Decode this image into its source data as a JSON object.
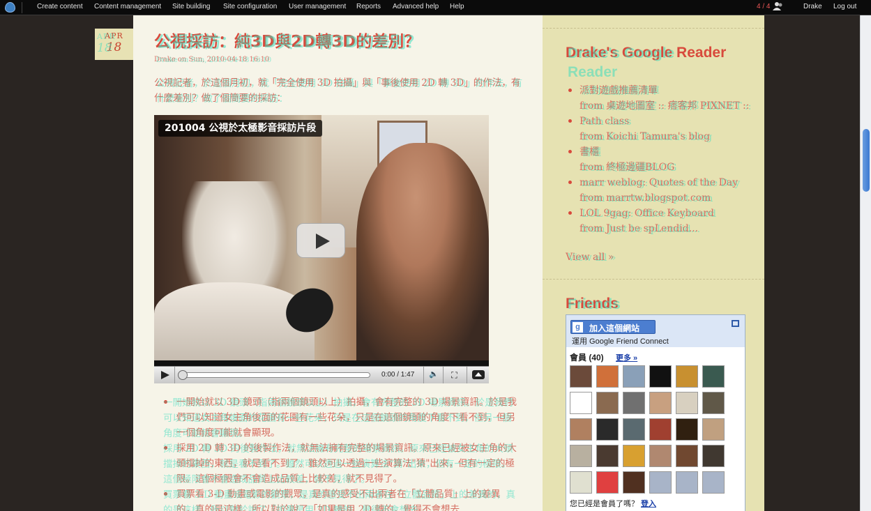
{
  "colors": {
    "accent": "#d84a3c",
    "ghost": "#40dcbe",
    "sidebar_bg": "#e6e2b2",
    "content_bg": "#f6f4e8"
  },
  "admin_bar": {
    "menu": [
      {
        "label": "Create content"
      },
      {
        "label": "Content management"
      },
      {
        "label": "Site building"
      },
      {
        "label": "Site configuration"
      },
      {
        "label": "User management"
      },
      {
        "label": "Reports"
      },
      {
        "label": "Advanced help"
      },
      {
        "label": "Help"
      }
    ],
    "user_count": "4 / 4",
    "user_name": "Drake",
    "logout": "Log out",
    "icons": [
      "drupal-logo",
      "users-icon"
    ]
  },
  "post": {
    "date_month": "APR",
    "date_day": "18",
    "title": "公視採訪：純3D與2D轉3D的差別？",
    "meta": "Drake on Sun, 2010-04-18 16:10",
    "intro": "公視記者，於這個月初，就「完全使用 3D 拍攝」與「事後使用 2D 轉 3D」的作法，有什麼差別？做了個簡要的採訪：",
    "video": {
      "caption": "201004 公視於太極影音採訪片段",
      "time": "0:00 / 1:47",
      "progress": 0
    },
    "bullets": [
      "一開始就以 3D 鏡頭（指兩個鏡頭以上）拍攝，會有完整的 3D 場景資訊。於是我們可以知道女主角後面的花園有一些花朵，只是在這個鏡頭的角度下看不到，但另一個角度可能就會顯現。",
      "採用 2D 轉 3D 的後製作法，就無法擁有完整的場景資訊。原來已經被女主角的大頭擋掉的東西，就是看不到了。雖然可以透過一些演算法\"猜\"出來，但有一定的極限。這個極限會不會造成品質上比較差，就不見得了。",
      "買票看 3-D 動畫或電影的觀眾，是真的感受不出兩者在「立體品質」上的差異的，真的是這樣。所以對於說了「如果是用 2D 轉的，覺得不會想去"
    ]
  },
  "sidebar": {
    "reader_title": "Drake's Google Reader",
    "reader_items": [
      {
        "title": "派對遊戲推薦清單",
        "source": "from 桌遊地圖室 :: 痞客邦 PIXNET ::"
      },
      {
        "title": "Path class",
        "source": "from Koichi Tamura's blog"
      },
      {
        "title": "書櫃",
        "source": "from 終極邊疆BLOG"
      },
      {
        "title": "marr weblog: Quotes of the Day",
        "source": "from marrtw.blogspot.com"
      },
      {
        "title": "LOL 9gag: Office Keyboard",
        "source": "from Just be spLendid..."
      }
    ],
    "view_all": "View all »",
    "friends_title": "Friends",
    "gfc": {
      "join_label": "加入這個網站",
      "sub": "運用 Google Friend Connect",
      "members": "會員 (40)",
      "more": "更多 »",
      "ask": "您已經是會員了嗎？",
      "login": "登入",
      "avatar_colors": [
        "#6b4a3a",
        "#d0703a",
        "#8aa0b8",
        "#111111",
        "#c89030",
        "#3a5a50",
        "#ffffff",
        "#8a6a50",
        "#707070",
        "#c8a080",
        "#d8d0c0",
        "#605848",
        "#b08060",
        "#2a2a2a",
        "#5a6a70",
        "#a04030",
        "#302010",
        "#c0a080",
        "#b8b0a0",
        "#4a3a30",
        "#d8a030",
        "#b08870",
        "#704830",
        "#403830",
        "#e0e0d0",
        "#e04040",
        "#503020",
        "#a8b4c8",
        "#a8b4c8",
        "#a8b4c8"
      ]
    }
  }
}
